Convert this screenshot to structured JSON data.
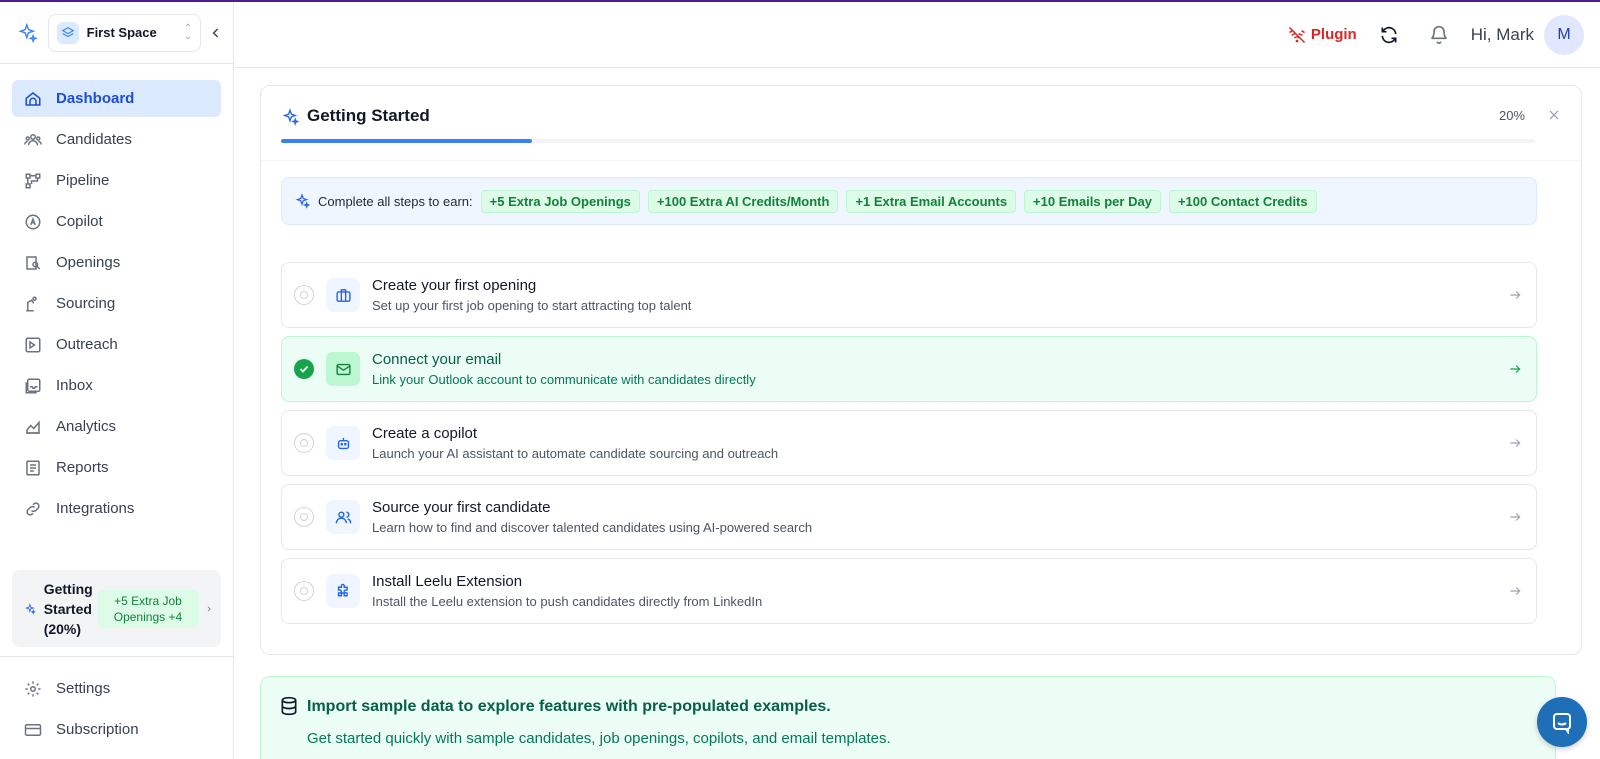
{
  "space": {
    "name": "First Space"
  },
  "sidebar": {
    "items": [
      {
        "label": "Dashboard",
        "icon": "dashboard-icon",
        "active": true
      },
      {
        "label": "Candidates",
        "icon": "candidates-icon"
      },
      {
        "label": "Pipeline",
        "icon": "pipeline-icon"
      },
      {
        "label": "Copilot",
        "icon": "copilot-icon"
      },
      {
        "label": "Openings",
        "icon": "openings-icon"
      },
      {
        "label": "Sourcing",
        "icon": "sourcing-icon"
      },
      {
        "label": "Outreach",
        "icon": "outreach-icon"
      },
      {
        "label": "Inbox",
        "icon": "inbox-icon"
      },
      {
        "label": "Analytics",
        "icon": "analytics-icon"
      },
      {
        "label": "Reports",
        "icon": "reports-icon"
      },
      {
        "label": "Integrations",
        "icon": "integrations-icon"
      }
    ],
    "getting_started": {
      "title": "Getting Started (20%)",
      "badge": "+5 Extra Job Openings +4"
    },
    "bottom": [
      {
        "label": "Settings",
        "icon": "settings-icon"
      },
      {
        "label": "Subscription",
        "icon": "subscription-icon"
      }
    ]
  },
  "header": {
    "plugin_label": "Plugin",
    "greeting": "Hi, Mark",
    "avatar_initial": "M"
  },
  "getting_started": {
    "title": "Getting Started",
    "percent_text": "20%",
    "progress": 0.2,
    "earn_label": "Complete all steps to earn:",
    "rewards": [
      "+5 Extra Job Openings",
      "+100 Extra AI Credits/Month",
      "+1 Extra Email Accounts",
      "+10 Emails per Day",
      "+100 Contact Credits"
    ],
    "steps": [
      {
        "title": "Create your first opening",
        "desc": "Set up your first job opening to start attracting top talent",
        "done": false,
        "icon": "briefcase-icon"
      },
      {
        "title": "Connect your email",
        "desc": "Link your Outlook account to communicate with candidates directly",
        "done": true,
        "icon": "mail-icon"
      },
      {
        "title": "Create a copilot",
        "desc": "Launch your AI assistant to automate candidate sourcing and outreach",
        "done": false,
        "icon": "bot-icon"
      },
      {
        "title": "Source your first candidate",
        "desc": "Learn how to find and discover talented candidates using AI-powered search",
        "done": false,
        "icon": "users-icon"
      },
      {
        "title": "Install Leelu Extension",
        "desc": "Install the Leelu extension to push candidates directly from LinkedIn",
        "done": false,
        "icon": "puzzle-icon"
      }
    ]
  },
  "import": {
    "title": "Import sample data to explore features with pre-populated examples.",
    "desc": "Get started quickly with sample candidates, job openings, copilots, and email templates."
  },
  "colors": {
    "accent": "#2563eb",
    "success": "#16a34a",
    "danger": "#dc2626"
  }
}
